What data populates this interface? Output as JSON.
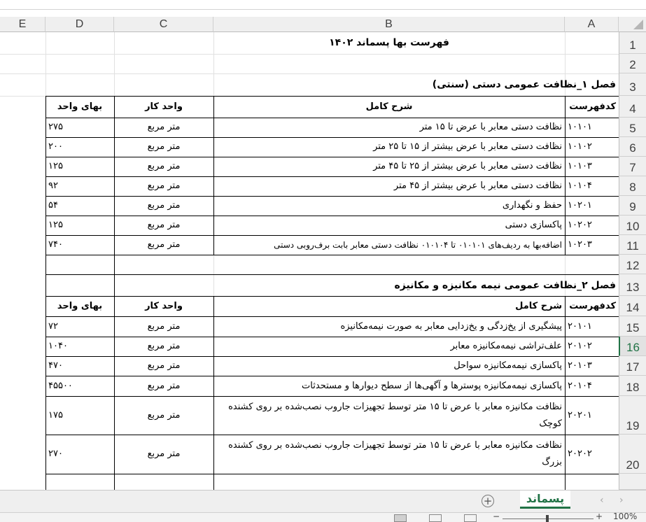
{
  "columns": [
    "E",
    "D",
    "C",
    "B",
    "A"
  ],
  "rows": [
    "1",
    "2",
    "3",
    "4",
    "5",
    "6",
    "7",
    "8",
    "9",
    "10",
    "11",
    "12",
    "13",
    "14",
    "15",
    "16",
    "17",
    "18",
    "19",
    "20",
    ""
  ],
  "title": "فهرست بها پسماند ۱۴۰۲",
  "section1": {
    "heading": "فصل ۱_نظافت عمومی دستی (سنتی)",
    "headers": {
      "code": "کدفهرست",
      "desc": "شرح کامل",
      "unit": "واحد کار",
      "price": "بهای واحد"
    },
    "items": [
      {
        "code": "۱۰۱۰۱",
        "desc": "نظافت دستی معابر با عرض تا ۱۵ متر",
        "unit": "متر مربع",
        "price": "۲۷۵"
      },
      {
        "code": "۱۰۱۰۲",
        "desc": "نظافت دستی معابر با عرض بیشتر از ۱۵ تا ۲۵ متر",
        "unit": "متر مربع",
        "price": "۲۰۰"
      },
      {
        "code": "۱۰۱۰۳",
        "desc": "نظافت دستی معابر با عرض بیشتر از ۲۵ تا ۴۵ متر",
        "unit": "متر مربع",
        "price": "۱۲۵"
      },
      {
        "code": "۱۰۱۰۴",
        "desc": "نظافت دستی معابر با عرض بیشتر از ۴۵ متر",
        "unit": "متر مربع",
        "price": "۹۲"
      },
      {
        "code": "۱۰۲۰۱",
        "desc": "حفظ و نگهداری",
        "unit": "متر مربع",
        "price": "۵۴"
      },
      {
        "code": "۱۰۲۰۲",
        "desc": "پاکسازی دستی",
        "unit": "متر مربع",
        "price": "۱۲۵"
      },
      {
        "code": "۱۰۲۰۳",
        "desc": "اضافه‌بها به ردیف‌های ۰۱۰۱۰۱ تا ۰۱۰۱۰۴ نظافت دستی معابر بابت برف‌روبی دستی",
        "unit": "متر مربع",
        "price": "۷۴۰"
      }
    ]
  },
  "section2": {
    "heading": "فصل ۲_نظافت عمومی نیمه مکانیزه و مکانیزه",
    "headers": {
      "code": "کدفهرست",
      "desc": "شرح کامل",
      "unit": "واحد کار",
      "price": "بهای واحد"
    },
    "items": [
      {
        "code": "۲۰۱۰۱",
        "desc": "پیشگیری از یخ‌زدگی و یخ‌زدایی معابر به صورت نیمه‌مکانیزه",
        "unit": "متر مربع",
        "price": "۷۲"
      },
      {
        "code": "۲۰۱۰۲",
        "desc": "علف‌تراشی نیمه‌مکانیزه معابر",
        "unit": "متر مربع",
        "price": "۱۰۴۰"
      },
      {
        "code": "۲۰۱۰۳",
        "desc": "پاکسازی نیمه‌مکانیزه سواحل",
        "unit": "متر مربع",
        "price": "۴۷۰"
      },
      {
        "code": "۲۰۱۰۴",
        "desc": "پاکسازی نیمه‌مکانیزه پوسترها و آگهی‌ها از سطح دیوارها و مستحدثات",
        "unit": "متر مربع",
        "price": "۴۵۵۰۰"
      },
      {
        "code": "۲۰۲۰۱",
        "desc_line1": "نظافت مکانیزه معابر با عرض تا ۱۵ متر توسط تجهیزات جاروب نصب‌شده بر روی کشنده",
        "desc_line2": "کوچک",
        "unit": "متر مربع",
        "price": "۱۷۵"
      },
      {
        "code": "۲۰۲۰۲",
        "desc_line1": "نظافت مکانیزه معابر با عرض تا ۱۵ متر توسط تجهیزات جاروب نصب‌شده بر روی کشنده",
        "desc_line2": "بزرگ",
        "unit": "متر مربع",
        "price": "۲۷۰"
      }
    ]
  },
  "sheet_tab": "پسماند",
  "add_sheet": "+",
  "zoom": "100%",
  "zoom_minus": "−",
  "zoom_plus": "+",
  "nav_prev": "‹",
  "nav_next": "›",
  "colors": {
    "accent": "#217346",
    "header_bg": "#efefef",
    "grid": "#e1e1e1"
  }
}
